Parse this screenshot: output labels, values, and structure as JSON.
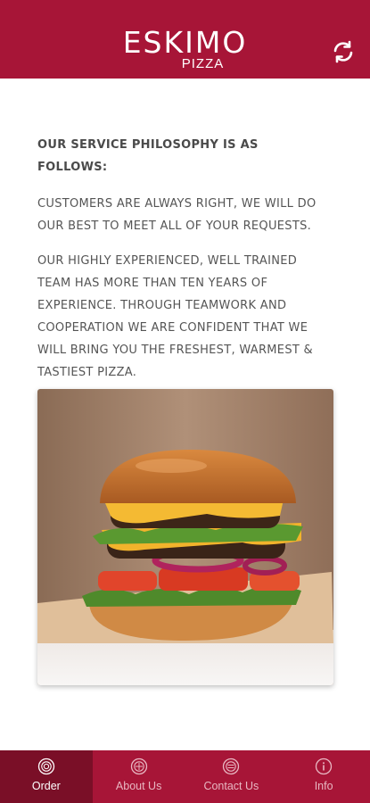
{
  "colors": {
    "brand": "#a71537",
    "brand_dark": "#7a0f27",
    "text": "#555555"
  },
  "header": {
    "logo_main": "ESKIMO",
    "logo_sub": "PIZZA",
    "refresh_icon": "refresh-icon"
  },
  "content": {
    "heading": "OUR SERVICE PHILOSOPHY IS AS FOLLOWS:",
    "paragraph1": "CUSTOMERS ARE ALWAYS RIGHT, WE WILL DO OUR BEST TO MEET ALL OF YOUR REQUESTS.",
    "paragraph2": "OUR HIGHLY EXPERIENCED, WELL TRAINED TEAM HAS MORE THAN TEN YEARS OF EXPERIENCE. THROUGH TEAMWORK AND COOPERATION WE ARE CONFIDENT THAT WE WILL BRING YOU THE FRESHEST, WARMEST & TASTIEST PIZZA.",
    "image": "burger-image"
  },
  "nav": {
    "items": [
      {
        "label": "Order",
        "icon": "order-icon",
        "active": true
      },
      {
        "label": "About Us",
        "icon": "about-icon",
        "active": false
      },
      {
        "label": "Contact Us",
        "icon": "contact-icon",
        "active": false
      },
      {
        "label": "Info",
        "icon": "info-icon",
        "active": false
      }
    ]
  }
}
